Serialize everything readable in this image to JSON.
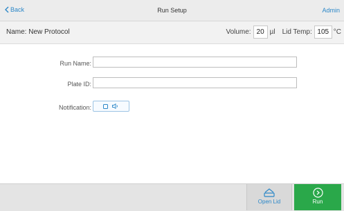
{
  "header": {
    "back_label": "Back",
    "title": "Run Setup",
    "admin_label": "Admin"
  },
  "info": {
    "name_label": "Name:",
    "name_value": "New Protocol",
    "volume_label": "Volume:",
    "volume_value": "20",
    "volume_unit": "µl",
    "lid_temp_label": "Lid Temp:",
    "lid_temp_value": "105",
    "lid_temp_unit": "°C"
  },
  "form": {
    "run_name_label": "Run Name:",
    "run_name_value": "",
    "plate_id_label": "Plate ID:",
    "plate_id_value": "",
    "notification_label": "Notification:"
  },
  "footer": {
    "open_lid_label": "Open Lid",
    "run_label": "Run"
  },
  "colors": {
    "accent": "#2b87c8",
    "run_green": "#2aa84a",
    "bar_bg": "#ececec",
    "footer_bg": "#e4e4e4"
  },
  "icons": {
    "back": "chevron-left-icon",
    "notification_screen": "square-icon",
    "notification_sound": "speaker-icon",
    "open_lid": "lid-icon",
    "run": "play-circle-icon"
  }
}
